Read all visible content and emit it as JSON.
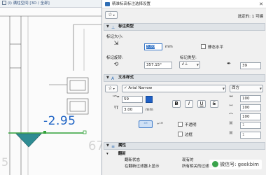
{
  "viewport": {
    "title": "(I) 满柱空间 [3D / 全部]",
    "dimension_value": "-2.95",
    "ghost_digit_left": "5",
    "ghost_digit_right": "67"
  },
  "dialog": {
    "title": "精准标高标注选择设置",
    "close_glyph": "✕",
    "selected_count": "选定的: 1 可编",
    "star_button": "☆",
    "sections": {
      "marker_type": "标注类型",
      "text_style": "文本样式",
      "properties": "属性"
    },
    "marker": {
      "size_label": "标记大小:",
      "size_value": "3.00",
      "size_unit": "mm",
      "static_horizontal_label": "静态水平",
      "angle_label": "标记旋转:",
      "angle_value": "357.15°",
      "type_label": "标记类型:",
      "pen_value": "39"
    },
    "text": {
      "font_name": "Arial Narrow",
      "script": "西方",
      "pen_value": "59",
      "size_value": "3.00",
      "size_unit": "mm",
      "bold": "B",
      "italic": "I",
      "underline": "U",
      "strike": "S",
      "width_pct": "100",
      "spacing_pct": "100",
      "slant_pct": "100",
      "small_btn_1": "¹²⁵",
      "small_btn_2": "+¹²⁵",
      "opaque_label": "不透明",
      "frame_label": "边框",
      "opaque_pen": "1",
      "frame_pen": "1"
    },
    "properties": {
      "group": "翻新",
      "rows": [
        {
          "name": "翻新状态",
          "value": "现有的"
        },
        {
          "name": "在翻新过滤器上显示",
          "value": "所有相关的过滤器"
        }
      ]
    }
  },
  "watermark": "微信号: geekbim"
}
